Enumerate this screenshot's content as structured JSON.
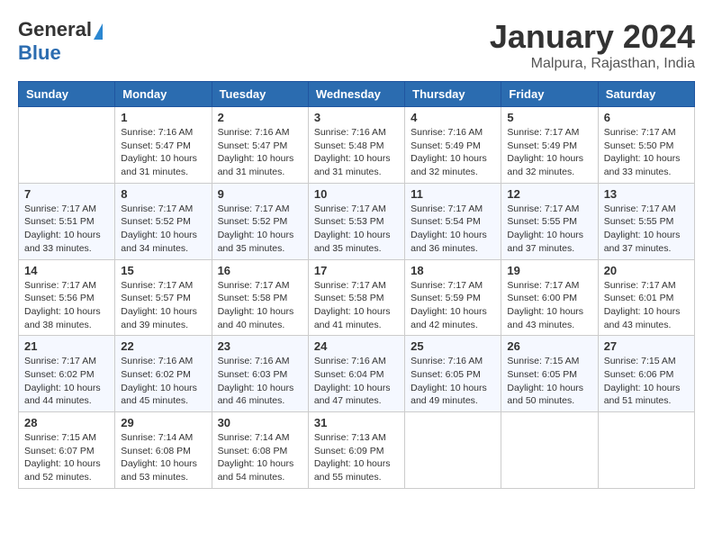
{
  "header": {
    "logo_general": "General",
    "logo_blue": "Blue",
    "month_title": "January 2024",
    "location": "Malpura, Rajasthan, India"
  },
  "weekdays": [
    "Sunday",
    "Monday",
    "Tuesday",
    "Wednesday",
    "Thursday",
    "Friday",
    "Saturday"
  ],
  "weeks": [
    [
      {
        "day": "",
        "info": ""
      },
      {
        "day": "1",
        "info": "Sunrise: 7:16 AM\nSunset: 5:47 PM\nDaylight: 10 hours\nand 31 minutes."
      },
      {
        "day": "2",
        "info": "Sunrise: 7:16 AM\nSunset: 5:47 PM\nDaylight: 10 hours\nand 31 minutes."
      },
      {
        "day": "3",
        "info": "Sunrise: 7:16 AM\nSunset: 5:48 PM\nDaylight: 10 hours\nand 31 minutes."
      },
      {
        "day": "4",
        "info": "Sunrise: 7:16 AM\nSunset: 5:49 PM\nDaylight: 10 hours\nand 32 minutes."
      },
      {
        "day": "5",
        "info": "Sunrise: 7:17 AM\nSunset: 5:49 PM\nDaylight: 10 hours\nand 32 minutes."
      },
      {
        "day": "6",
        "info": "Sunrise: 7:17 AM\nSunset: 5:50 PM\nDaylight: 10 hours\nand 33 minutes."
      }
    ],
    [
      {
        "day": "7",
        "info": "Sunrise: 7:17 AM\nSunset: 5:51 PM\nDaylight: 10 hours\nand 33 minutes."
      },
      {
        "day": "8",
        "info": "Sunrise: 7:17 AM\nSunset: 5:52 PM\nDaylight: 10 hours\nand 34 minutes."
      },
      {
        "day": "9",
        "info": "Sunrise: 7:17 AM\nSunset: 5:52 PM\nDaylight: 10 hours\nand 35 minutes."
      },
      {
        "day": "10",
        "info": "Sunrise: 7:17 AM\nSunset: 5:53 PM\nDaylight: 10 hours\nand 35 minutes."
      },
      {
        "day": "11",
        "info": "Sunrise: 7:17 AM\nSunset: 5:54 PM\nDaylight: 10 hours\nand 36 minutes."
      },
      {
        "day": "12",
        "info": "Sunrise: 7:17 AM\nSunset: 5:55 PM\nDaylight: 10 hours\nand 37 minutes."
      },
      {
        "day": "13",
        "info": "Sunrise: 7:17 AM\nSunset: 5:55 PM\nDaylight: 10 hours\nand 37 minutes."
      }
    ],
    [
      {
        "day": "14",
        "info": "Sunrise: 7:17 AM\nSunset: 5:56 PM\nDaylight: 10 hours\nand 38 minutes."
      },
      {
        "day": "15",
        "info": "Sunrise: 7:17 AM\nSunset: 5:57 PM\nDaylight: 10 hours\nand 39 minutes."
      },
      {
        "day": "16",
        "info": "Sunrise: 7:17 AM\nSunset: 5:58 PM\nDaylight: 10 hours\nand 40 minutes."
      },
      {
        "day": "17",
        "info": "Sunrise: 7:17 AM\nSunset: 5:58 PM\nDaylight: 10 hours\nand 41 minutes."
      },
      {
        "day": "18",
        "info": "Sunrise: 7:17 AM\nSunset: 5:59 PM\nDaylight: 10 hours\nand 42 minutes."
      },
      {
        "day": "19",
        "info": "Sunrise: 7:17 AM\nSunset: 6:00 PM\nDaylight: 10 hours\nand 43 minutes."
      },
      {
        "day": "20",
        "info": "Sunrise: 7:17 AM\nSunset: 6:01 PM\nDaylight: 10 hours\nand 43 minutes."
      }
    ],
    [
      {
        "day": "21",
        "info": "Sunrise: 7:17 AM\nSunset: 6:02 PM\nDaylight: 10 hours\nand 44 minutes."
      },
      {
        "day": "22",
        "info": "Sunrise: 7:16 AM\nSunset: 6:02 PM\nDaylight: 10 hours\nand 45 minutes."
      },
      {
        "day": "23",
        "info": "Sunrise: 7:16 AM\nSunset: 6:03 PM\nDaylight: 10 hours\nand 46 minutes."
      },
      {
        "day": "24",
        "info": "Sunrise: 7:16 AM\nSunset: 6:04 PM\nDaylight: 10 hours\nand 47 minutes."
      },
      {
        "day": "25",
        "info": "Sunrise: 7:16 AM\nSunset: 6:05 PM\nDaylight: 10 hours\nand 49 minutes."
      },
      {
        "day": "26",
        "info": "Sunrise: 7:15 AM\nSunset: 6:05 PM\nDaylight: 10 hours\nand 50 minutes."
      },
      {
        "day": "27",
        "info": "Sunrise: 7:15 AM\nSunset: 6:06 PM\nDaylight: 10 hours\nand 51 minutes."
      }
    ],
    [
      {
        "day": "28",
        "info": "Sunrise: 7:15 AM\nSunset: 6:07 PM\nDaylight: 10 hours\nand 52 minutes."
      },
      {
        "day": "29",
        "info": "Sunrise: 7:14 AM\nSunset: 6:08 PM\nDaylight: 10 hours\nand 53 minutes."
      },
      {
        "day": "30",
        "info": "Sunrise: 7:14 AM\nSunset: 6:08 PM\nDaylight: 10 hours\nand 54 minutes."
      },
      {
        "day": "31",
        "info": "Sunrise: 7:13 AM\nSunset: 6:09 PM\nDaylight: 10 hours\nand 55 minutes."
      },
      {
        "day": "",
        "info": ""
      },
      {
        "day": "",
        "info": ""
      },
      {
        "day": "",
        "info": ""
      }
    ]
  ]
}
